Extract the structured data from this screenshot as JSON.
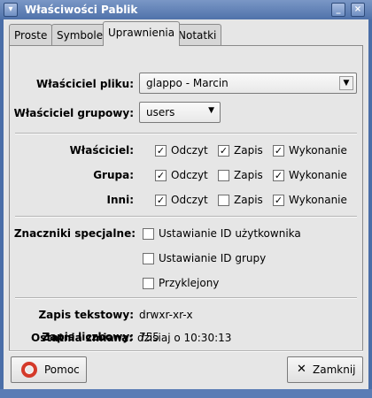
{
  "window": {
    "title": "Właściwości Pablik",
    "menu_icon": "chevron-down-icon",
    "minimize_symbol": "_",
    "close_symbol": "×"
  },
  "tabs": [
    {
      "label": "Proste"
    },
    {
      "label": "Symbole"
    },
    {
      "label": "Uprawnienia",
      "active": true
    },
    {
      "label": "Notatki"
    }
  ],
  "owner": {
    "label": "Właściciel pliku:",
    "value": "glappo - Marcin"
  },
  "group_owner": {
    "label": "Właściciel grupowy:",
    "value": "users"
  },
  "permissions": {
    "read_label": "Odczyt",
    "write_label": "Zapis",
    "exec_label": "Wykonanie",
    "rows": [
      {
        "label": "Właściciel:",
        "read": true,
        "write": true,
        "exec": true
      },
      {
        "label": "Grupa:",
        "read": true,
        "write": false,
        "exec": true
      },
      {
        "label": "Inni:",
        "read": true,
        "write": false,
        "exec": true
      }
    ]
  },
  "special_flags": {
    "label": "Znaczniki specjalne:",
    "options": [
      {
        "label": "Ustawianie ID użytkownika",
        "checked": false
      },
      {
        "label": "Ustawianie ID grupy",
        "checked": false
      },
      {
        "label": "Przyklejony",
        "checked": false
      }
    ]
  },
  "info": {
    "text_label": "Zapis tekstowy:",
    "text_value": "drwxr-xr-x",
    "numeric_label": "Zapis liczbowy:",
    "numeric_value": "755",
    "modified_label": "Ostatnia zmiana:",
    "modified_value": "dzisiaj o 10:30:13"
  },
  "buttons": {
    "help": "Pomoc",
    "close": "Zamknij"
  },
  "check_mark": "✓"
}
